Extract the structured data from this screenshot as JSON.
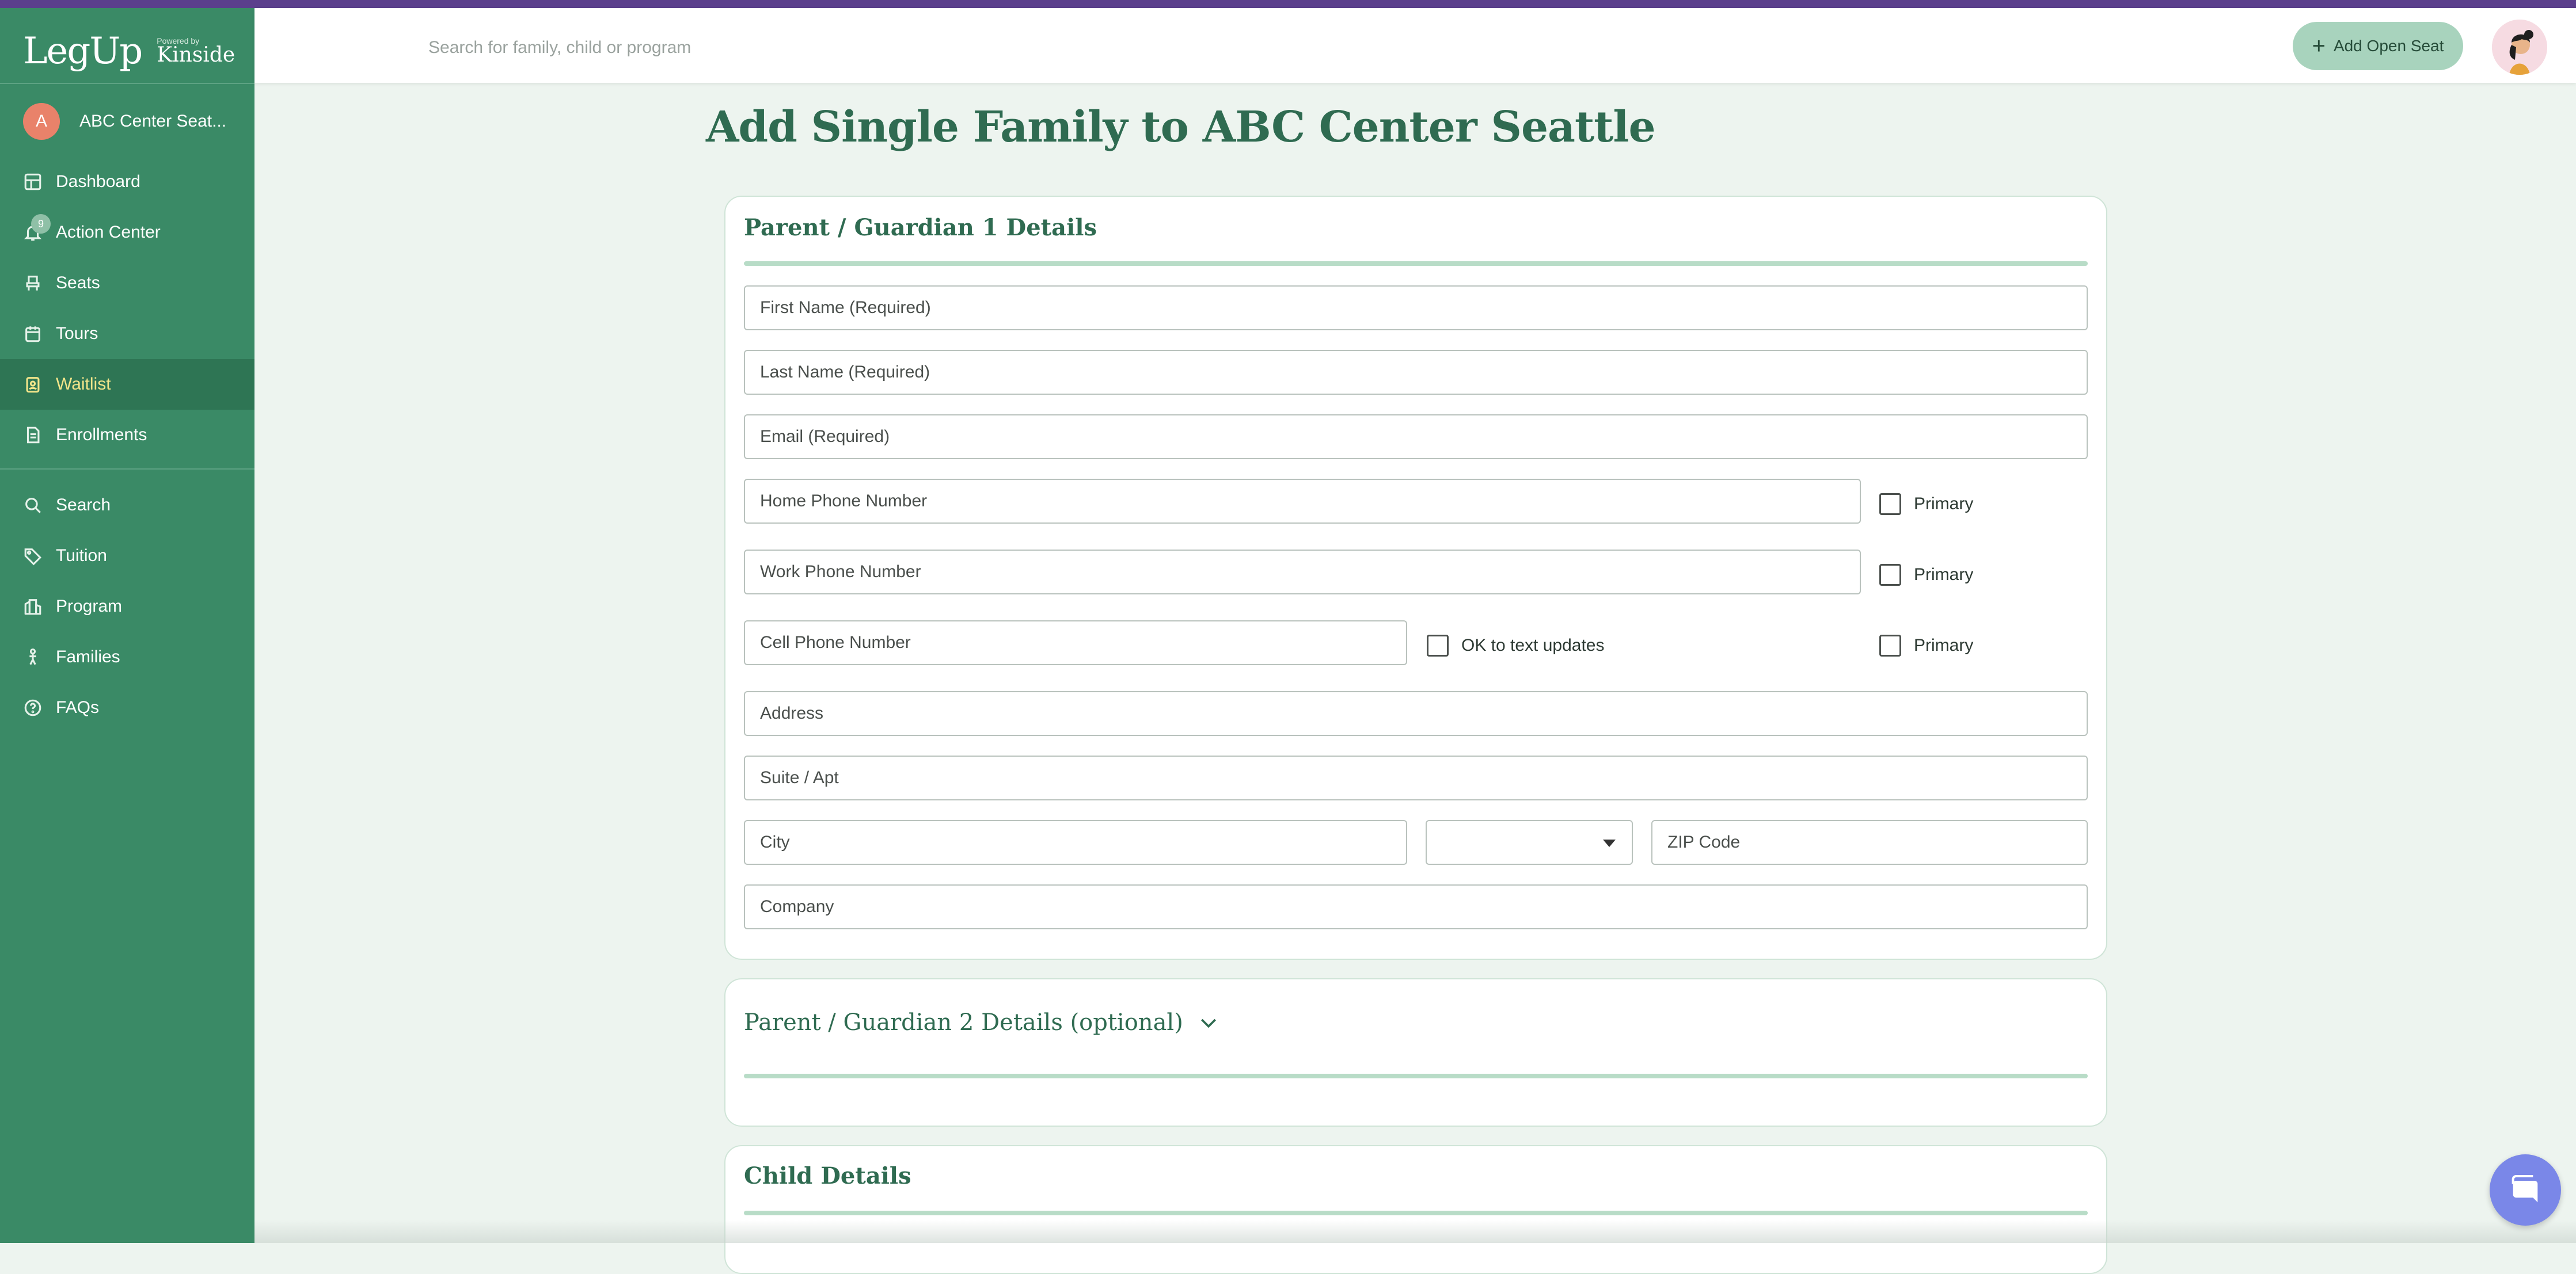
{
  "app": {
    "logo_main": "LegUp",
    "logo_powered": "Powered by",
    "logo_brand": "Kinside"
  },
  "sidebar": {
    "center_initial": "A",
    "center_name": "ABC Center Seat...",
    "items": [
      {
        "label": "Dashboard",
        "icon": "dashboard-icon"
      },
      {
        "label": "Action Center",
        "icon": "bell-icon",
        "badge": "9"
      },
      {
        "label": "Seats",
        "icon": "seat-icon"
      },
      {
        "label": "Tours",
        "icon": "calendar-icon"
      },
      {
        "label": "Waitlist",
        "icon": "clipboard-icon",
        "active": true
      },
      {
        "label": "Enrollments",
        "icon": "document-icon"
      },
      {
        "label": "Search",
        "icon": "search-icon"
      },
      {
        "label": "Tuition",
        "icon": "tag-icon"
      },
      {
        "label": "Program",
        "icon": "building-icon"
      },
      {
        "label": "Families",
        "icon": "person-icon"
      },
      {
        "label": "FAQs",
        "icon": "question-icon"
      }
    ]
  },
  "topbar": {
    "search_placeholder": "Search for family, child or program",
    "add_seat_label": "Add Open Seat"
  },
  "page": {
    "title": "Add Single Family to ABC Center Seattle"
  },
  "guardian1": {
    "title": "Parent / Guardian 1 Details",
    "first_name_placeholder": "First Name (Required)",
    "last_name_placeholder": "Last Name (Required)",
    "email_placeholder": "Email (Required)",
    "home_phone_placeholder": "Home Phone Number",
    "work_phone_placeholder": "Work Phone Number",
    "cell_phone_placeholder": "Cell Phone Number",
    "primary_label": "Primary",
    "ok_text_label": "OK to text updates",
    "address_placeholder": "Address",
    "suite_placeholder": "Suite / Apt",
    "city_placeholder": "City",
    "state_value": "",
    "zip_placeholder": "ZIP Code",
    "company_placeholder": "Company"
  },
  "guardian2": {
    "title": "Parent / Guardian 2 Details (optional)"
  },
  "child": {
    "title": "Child Details"
  },
  "colors": {
    "sidebar": "#3a8a66",
    "sidebar_active": "#2e7554",
    "accent": "#2f6b51",
    "button": "#a8d3bd",
    "chat": "#7a87e8"
  }
}
